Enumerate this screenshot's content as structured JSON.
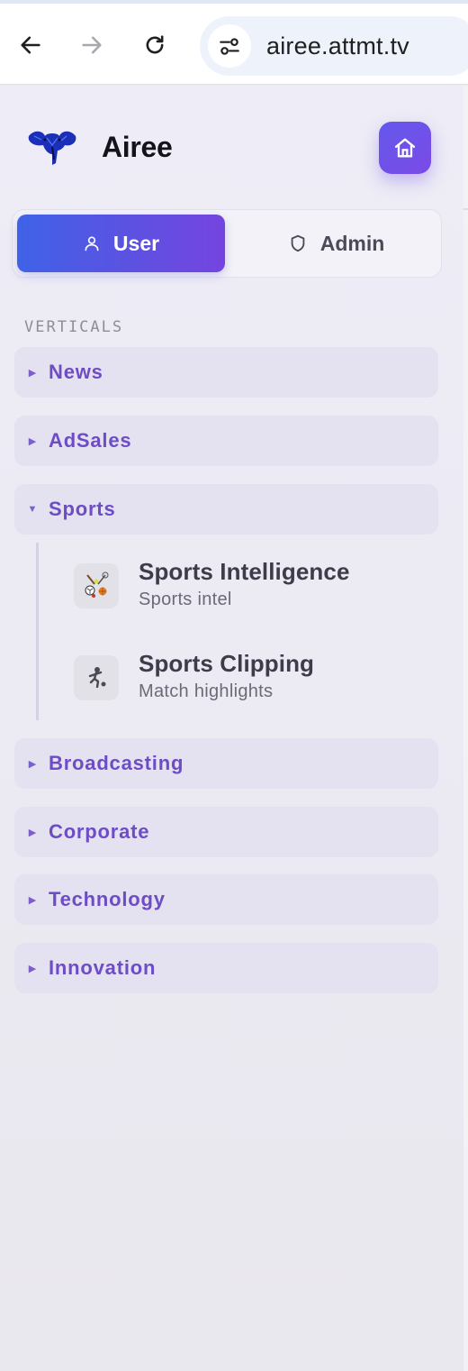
{
  "browser": {
    "url": "airee.attmt.tv",
    "icons": [
      "back-arrow-icon",
      "forward-arrow-icon",
      "reload-icon",
      "site-settings-icon"
    ]
  },
  "brand": {
    "name": "Airee",
    "logo_icon": "elephant-logo-icon",
    "home_icon": "home-icon"
  },
  "mode_switch": {
    "user_label": "User",
    "admin_label": "Admin",
    "active": "User",
    "user_icon": "user-icon",
    "admin_icon": "shield-icon"
  },
  "sidebar": {
    "section_label": "VERTICALS",
    "verticals": [
      {
        "label": "News",
        "expanded": false
      },
      {
        "label": "AdSales",
        "expanded": false
      },
      {
        "label": "Sports",
        "expanded": true,
        "items": [
          {
            "title": "Sports Intelligence",
            "desc": "Sports intel",
            "icon": "sports-equipment-icon"
          },
          {
            "title": "Sports Clipping",
            "desc": "Match highlights",
            "icon": "soccer-player-icon"
          }
        ]
      },
      {
        "label": "Broadcasting",
        "expanded": false
      },
      {
        "label": "Corporate",
        "expanded": false
      },
      {
        "label": "Technology",
        "expanded": false
      },
      {
        "label": "Innovation",
        "expanded": false
      }
    ]
  },
  "colors": {
    "accent": "#6d4cc6",
    "user_gradient_start": "#3f62e6",
    "user_gradient_end": "#7544df",
    "vertical_bg": "#e4e1f0"
  }
}
